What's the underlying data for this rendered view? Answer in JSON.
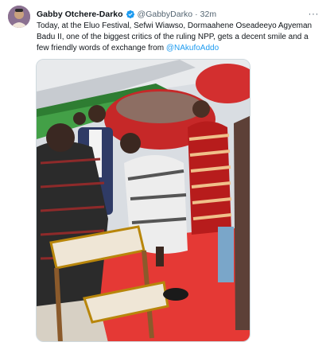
{
  "tweet": {
    "author_name": "Gabby Otchere-Darko",
    "handle": "@GabbyDarko",
    "separator": "·",
    "time": "32m",
    "more_label": "···",
    "text_before_mention": "Today, at  the Eluo Festival, Sefwi Wiawso, Dormaahene Oseadeeyo Agyeman Badu II, one of the biggest critics of the ruling NPP, gets a decent smile and a few friendly words of exchange from ",
    "mention": "@NAkufoAddo"
  },
  "icons": {
    "verified": "verified-badge-icon",
    "more": "more-options-icon"
  },
  "colors": {
    "link": "#1d9bf0",
    "verified": "#1d9bf0",
    "secondary_text": "#536471"
  }
}
